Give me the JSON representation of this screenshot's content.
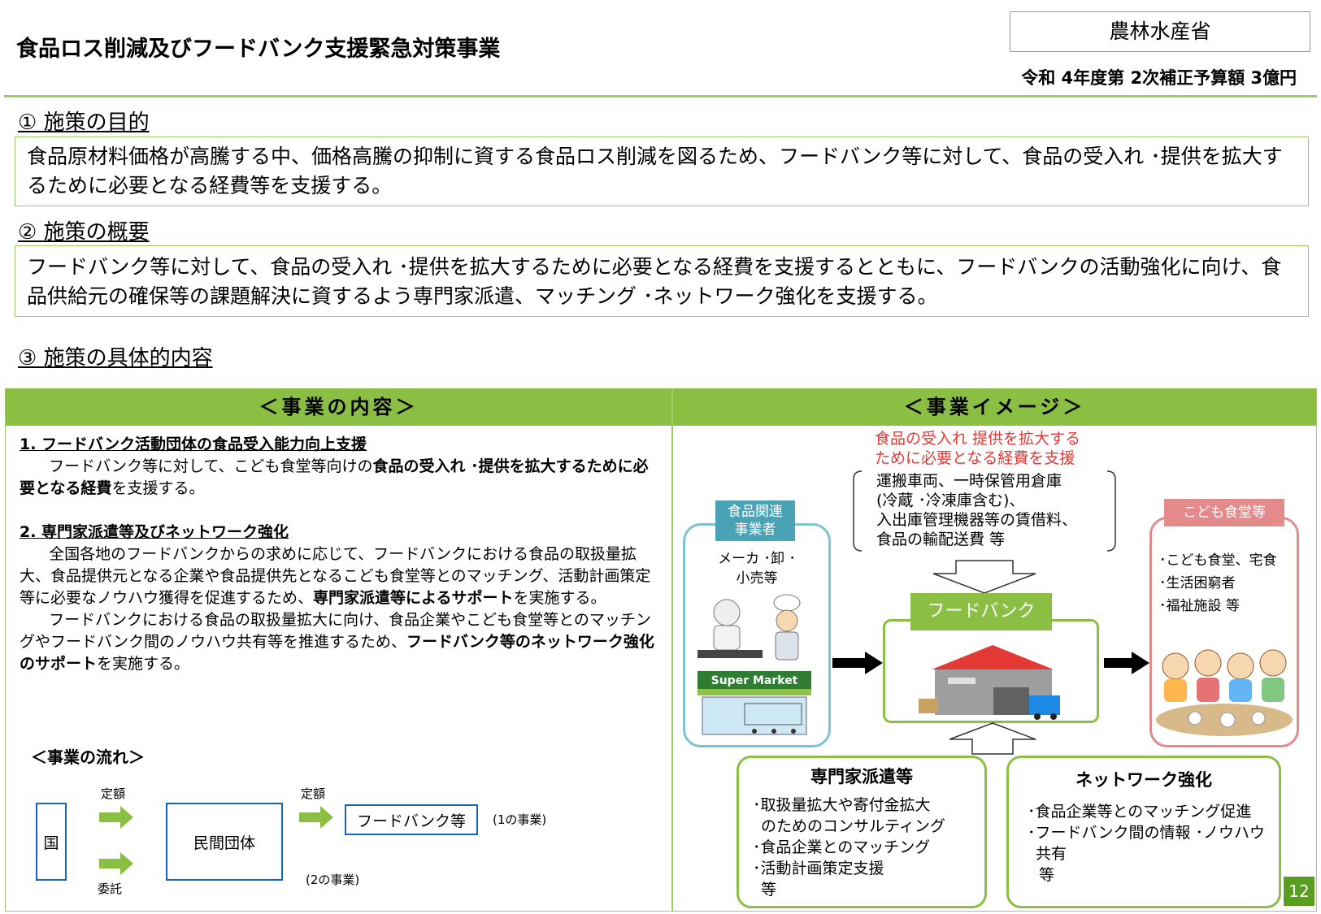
{
  "header": {
    "title": "食品ロス削減及びフードバンク支援緊急対策事業",
    "ministry": "農林水産省",
    "budget": "令和 4年度第 2次補正予算額 3億円"
  },
  "section1": {
    "heading": "① 施策の目的",
    "body": "食品原材料価格が高騰する中、価格高騰の抑制に資する食品ロス削減を図るため、フードバンク等に対して、食品の受入れ ･提供を拡大するために必要となる経費等を支援する。"
  },
  "section2": {
    "heading": "② 施策の概要",
    "body": "フードバンク等に対して、食品の受入れ ･提供を拡大するために必要となる経費を支援するとともに、フードバンクの活動強化に向け、食品供給元の確保等の課題解決に資するよう専門家派遣、マッチング ･ネットワーク強化を支援する。"
  },
  "section3": {
    "heading": "③ 施策の具体的内容"
  },
  "left": {
    "header": "＜事業の内容＞",
    "item1_title": "1. フードバンク活動団体の食品受入能力向上支援",
    "item1_a": "フードバンク等に対して、こども食堂等向けの",
    "item1_b": "食品の受入れ ･提供を拡大するために必要となる経費",
    "item1_c": "を支援する。",
    "item2_title": "2. 専門家派遣等及びネットワーク強化",
    "item2_p1a": "全国各地のフードバンクからの求めに応じて、フードバンクにおける食品の取扱量拡大、食品提供元となる企業や食品提供先となるこども食堂等とのマッチング、活動計画策定等に必要なノウハウ獲得を促進するため、",
    "item2_p1b": "専門家派遣等によるサポート",
    "item2_p1c": "を実施する。",
    "item2_p2a": "フードバンクにおける食品の取扱量拡大に向け、食品企業やこども食堂等とのマッチングやフードバンク間のノウハウ共有等を推進するため、",
    "item2_p2b": "フードバンク等のネットワーク強化のサポート",
    "item2_p2c": "を実施する。",
    "flow_title": "＜事業の流れ＞",
    "flow": {
      "country": "国",
      "teigaku1": "定額",
      "itaku": "委託",
      "private": "民間団体",
      "teigaku2": "定額",
      "foodbank": "フードバンク等",
      "note1": "(1の事業)",
      "note2": "(2の事業)"
    }
  },
  "right": {
    "header": "＜事業イメージ＞",
    "red_line1": "食品の受入れ 提供を拡大する",
    "red_line2": "ために必要となる経費を支援",
    "costs": [
      "運搬車両、一時保管用倉庫",
      "(冷蔵 ･冷凍庫含む)、",
      "入出庫管理機器等の賃借料、",
      "食品の輸配送費 等"
    ],
    "food_tag1": "食品関連",
    "food_tag2": "事業者",
    "food_desc1": "メーカ ･卸 ･",
    "food_desc2": "小売等",
    "supermarket": "Super Market",
    "foodbank_label": "フードバンク",
    "kids_tag": "こども食堂等",
    "kids_items": [
      "･こども食堂、宅食",
      "･生活困窮者",
      "･福祉施設 等"
    ],
    "expert_title": "専門家派遣等",
    "expert_items": [
      "･取扱量拡大や寄付金拡大",
      "のためのコンサルティング",
      "･食品企業とのマッチング",
      "･活動計画策定支援",
      "等"
    ],
    "network_title": "ネットワーク強化",
    "network_items": [
      "･食品企業等とのマッチング促進",
      "･フードバンク間の情報 ･ノウハウ",
      "共有",
      "等"
    ]
  },
  "page_number": "12",
  "colors": {
    "green": "#8bbf44",
    "border_green": "#9ccc65",
    "blue": "#1565c0",
    "red": "#e53935",
    "pink": "#e48a8a",
    "teal": "#4aa3b5"
  }
}
